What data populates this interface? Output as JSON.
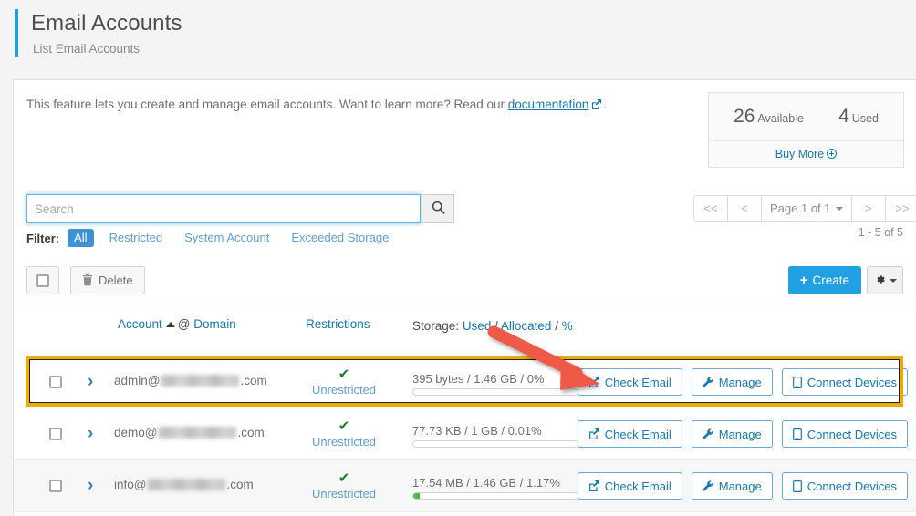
{
  "header": {
    "title": "Email Accounts",
    "subtitle": "List Email Accounts"
  },
  "intro": {
    "text_before": "This feature lets you create and manage email accounts. Want to learn more? Read our ",
    "link_label": "documentation",
    "link_icon": "external-link-icon",
    "text_after": "."
  },
  "quota": {
    "available_value": "26",
    "available_label": "Available",
    "used_value": "4",
    "used_label": "Used",
    "buy_more_label": "Buy More",
    "buy_more_icon": "circle-plus-icon"
  },
  "search": {
    "value": "",
    "placeholder": "Search",
    "button_icon": "search-icon"
  },
  "filter": {
    "label": "Filter:",
    "options": [
      {
        "label": "All",
        "active": true
      },
      {
        "label": "Restricted",
        "active": false
      },
      {
        "label": "System Account",
        "active": false
      },
      {
        "label": "Exceeded Storage",
        "active": false
      }
    ]
  },
  "pagination": {
    "first_label": "<<",
    "prev_label": "<",
    "page_label": "Page 1 of 1",
    "next_label": ">",
    "last_label": ">>",
    "range_text": "1 - 5 of 5"
  },
  "toolbar": {
    "select_all_name": "select-all-checkbox",
    "delete_label": "Delete",
    "delete_icon": "trash-icon",
    "create_label": "Create",
    "create_icon": "plus-icon",
    "gear_icon": "gear-icon"
  },
  "table": {
    "columns": {
      "account": "Account",
      "account_sort_icon": "sort-ascending-icon",
      "account_at": "@",
      "domain": "Domain",
      "restrictions": "Restrictions",
      "storage_static": "Storage:",
      "storage_used": "Used",
      "storage_sep1": "/",
      "storage_allocated": "Allocated",
      "storage_sep2": "/",
      "storage_percent": "%"
    },
    "action_labels": {
      "check_email": "Check Email",
      "check_email_icon": "external-link-icon",
      "manage": "Manage",
      "manage_icon": "wrench-icon",
      "connect_devices": "Connect Devices",
      "connect_devices_icon": "mobile-device-icon"
    },
    "rows": [
      {
        "user": "admin@",
        "domain_redacted": true,
        "domain_tld": ".com",
        "restriction_icon": "check-icon",
        "restriction": "Unrestricted",
        "storage": "395 bytes / 1.46 GB / 0%",
        "storage_percent": 0,
        "highlighted": true
      },
      {
        "user": "demo@",
        "domain_redacted": true,
        "domain_tld": ".com",
        "restriction_icon": "check-icon",
        "restriction": "Unrestricted",
        "storage": "77.73 KB / 1 GB / 0.01%",
        "storage_percent": 0.01,
        "highlighted": false
      },
      {
        "user": "info@",
        "domain_redacted": true,
        "domain_tld": ".com",
        "restriction_icon": "check-icon",
        "restriction": "Unrestricted",
        "storage": "17.54 MB / 1.46 GB / 1.17%",
        "storage_percent": 4,
        "highlighted": false
      }
    ]
  },
  "annotations": {
    "highlight_color": "#ecab09",
    "arrow_color": "#ee5a47",
    "arrow_target": "check-email-button-row-1"
  }
}
